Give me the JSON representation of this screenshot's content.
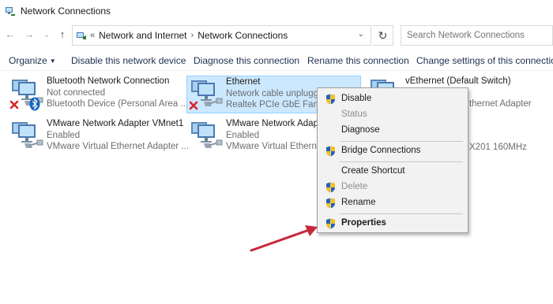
{
  "window": {
    "title": "Network Connections"
  },
  "address": {
    "crumbs": [
      "Network and Internet",
      "Network Connections"
    ],
    "separator_first": "«",
    "separator": "›"
  },
  "search": {
    "placeholder": "Search Network Connections"
  },
  "toolbar": {
    "organize": "Organize",
    "disable": "Disable this network device",
    "diagnose": "Diagnose this connection",
    "rename": "Rename this connection",
    "change_settings": "Change settings of this connection"
  },
  "connections": [
    {
      "name": "Bluetooth Network Connection",
      "status": "Not connected",
      "device": "Bluetooth Device (Personal Area ..."
    },
    {
      "name": "Ethernet",
      "status": "Network cable unplugge",
      "device": "Realtek PCIe GbE Family"
    },
    {
      "name": "vEthernet (Default Switch)",
      "status": "",
      "device": "thernet Adapter"
    },
    {
      "name": "VMware Network Adapter VMnet1",
      "status": "Enabled",
      "device": "VMware Virtual Ethernet Adapter ..."
    },
    {
      "name": "VMware Network Adapte",
      "status": "Enabled",
      "device": "VMware Virtual Ethernet"
    },
    {
      "name": "",
      "status": "",
      "device": "X201 160MHz"
    }
  ],
  "context_menu": {
    "items": [
      {
        "label": "Disable",
        "enabled": true,
        "shield": true
      },
      {
        "label": "Status",
        "enabled": false,
        "shield": false
      },
      {
        "label": "Diagnose",
        "enabled": true,
        "shield": false
      },
      {
        "label": "Bridge Connections",
        "enabled": true,
        "shield": true
      },
      {
        "label": "Create Shortcut",
        "enabled": true,
        "shield": false
      },
      {
        "label": "Delete",
        "enabled": false,
        "shield": true
      },
      {
        "label": "Rename",
        "enabled": true,
        "shield": true
      },
      {
        "label": "Properties",
        "enabled": true,
        "shield": true,
        "default": true
      }
    ]
  },
  "colors": {
    "selection_bg": "#cce8ff",
    "selection_border": "#99d1ff",
    "annotation_arrow": "#c8283c",
    "error_x": "#d8262b",
    "bluetooth": "#1565c0"
  }
}
